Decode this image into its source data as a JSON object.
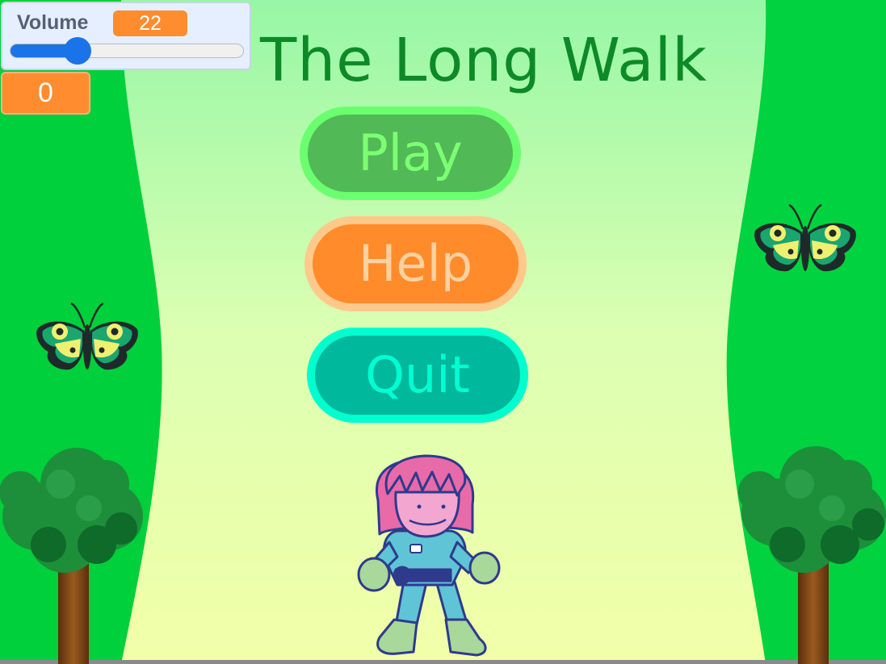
{
  "game": {
    "title": "The Long Walk",
    "menu": {
      "play_label": "Play",
      "help_label": "Help",
      "quit_label": "Quit"
    }
  },
  "monitors": {
    "volume_label": "Volume",
    "volume_value": "22",
    "volume_fraction": 0.22,
    "score_value": "0"
  },
  "colors": {
    "grass": "#00d33f",
    "path_top": "#96f7a6",
    "path_bottom": "#f2ffa8",
    "title": "#0d8a27",
    "play_fill": "#52b957",
    "help_fill": "#ff8b2b",
    "quit_fill": "#00b89c",
    "monitor_orange": "#ff8c2e"
  },
  "sprites": [
    "butterfly",
    "butterfly",
    "tree",
    "tree",
    "walker-character"
  ]
}
